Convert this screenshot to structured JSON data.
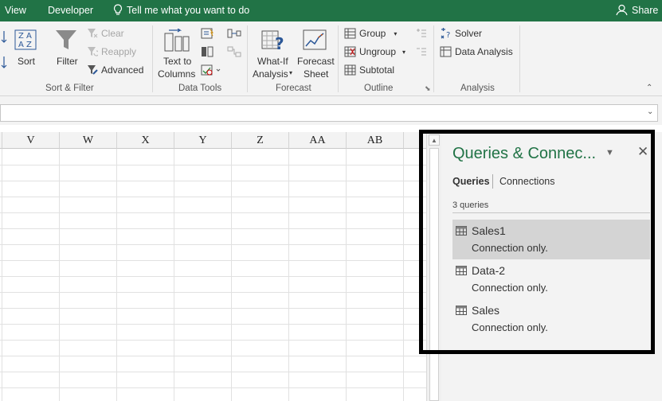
{
  "tabs": {
    "view": "View",
    "developer": "Developer",
    "tell_me": "Tell me what you want to do",
    "share": "Share"
  },
  "ribbon": {
    "sort_filter": {
      "sort": "Sort",
      "filter": "Filter",
      "clear": "Clear",
      "reapply": "Reapply",
      "advanced": "Advanced",
      "label": "Sort & Filter"
    },
    "data_tools": {
      "text_to_columns_1": "Text to",
      "text_to_columns_2": "Columns",
      "label": "Data Tools"
    },
    "forecast": {
      "whatif_1": "What-If",
      "whatif_2": "Analysis",
      "sheet_1": "Forecast",
      "sheet_2": "Sheet",
      "label": "Forecast"
    },
    "outline": {
      "group": "Group",
      "ungroup": "Ungroup",
      "subtotal": "Subtotal",
      "label": "Outline"
    },
    "analysis": {
      "solver": "Solver",
      "data_analysis": "Data Analysis",
      "label": "Analysis"
    }
  },
  "columns": [
    "V",
    "W",
    "X",
    "Y",
    "Z",
    "AA",
    "AB"
  ],
  "pane": {
    "title": "Queries & Connec...",
    "tab_queries": "Queries",
    "tab_connections": "Connections",
    "count": "3 queries",
    "items": [
      {
        "name": "Sales1",
        "desc": "Connection only."
      },
      {
        "name": "Data-2",
        "desc": "Connection only."
      },
      {
        "name": "Sales",
        "desc": "Connection only."
      }
    ]
  },
  "colors": {
    "accent": "#217346",
    "highlight_border": "#000000",
    "selected_row": "#d4d4d4"
  }
}
